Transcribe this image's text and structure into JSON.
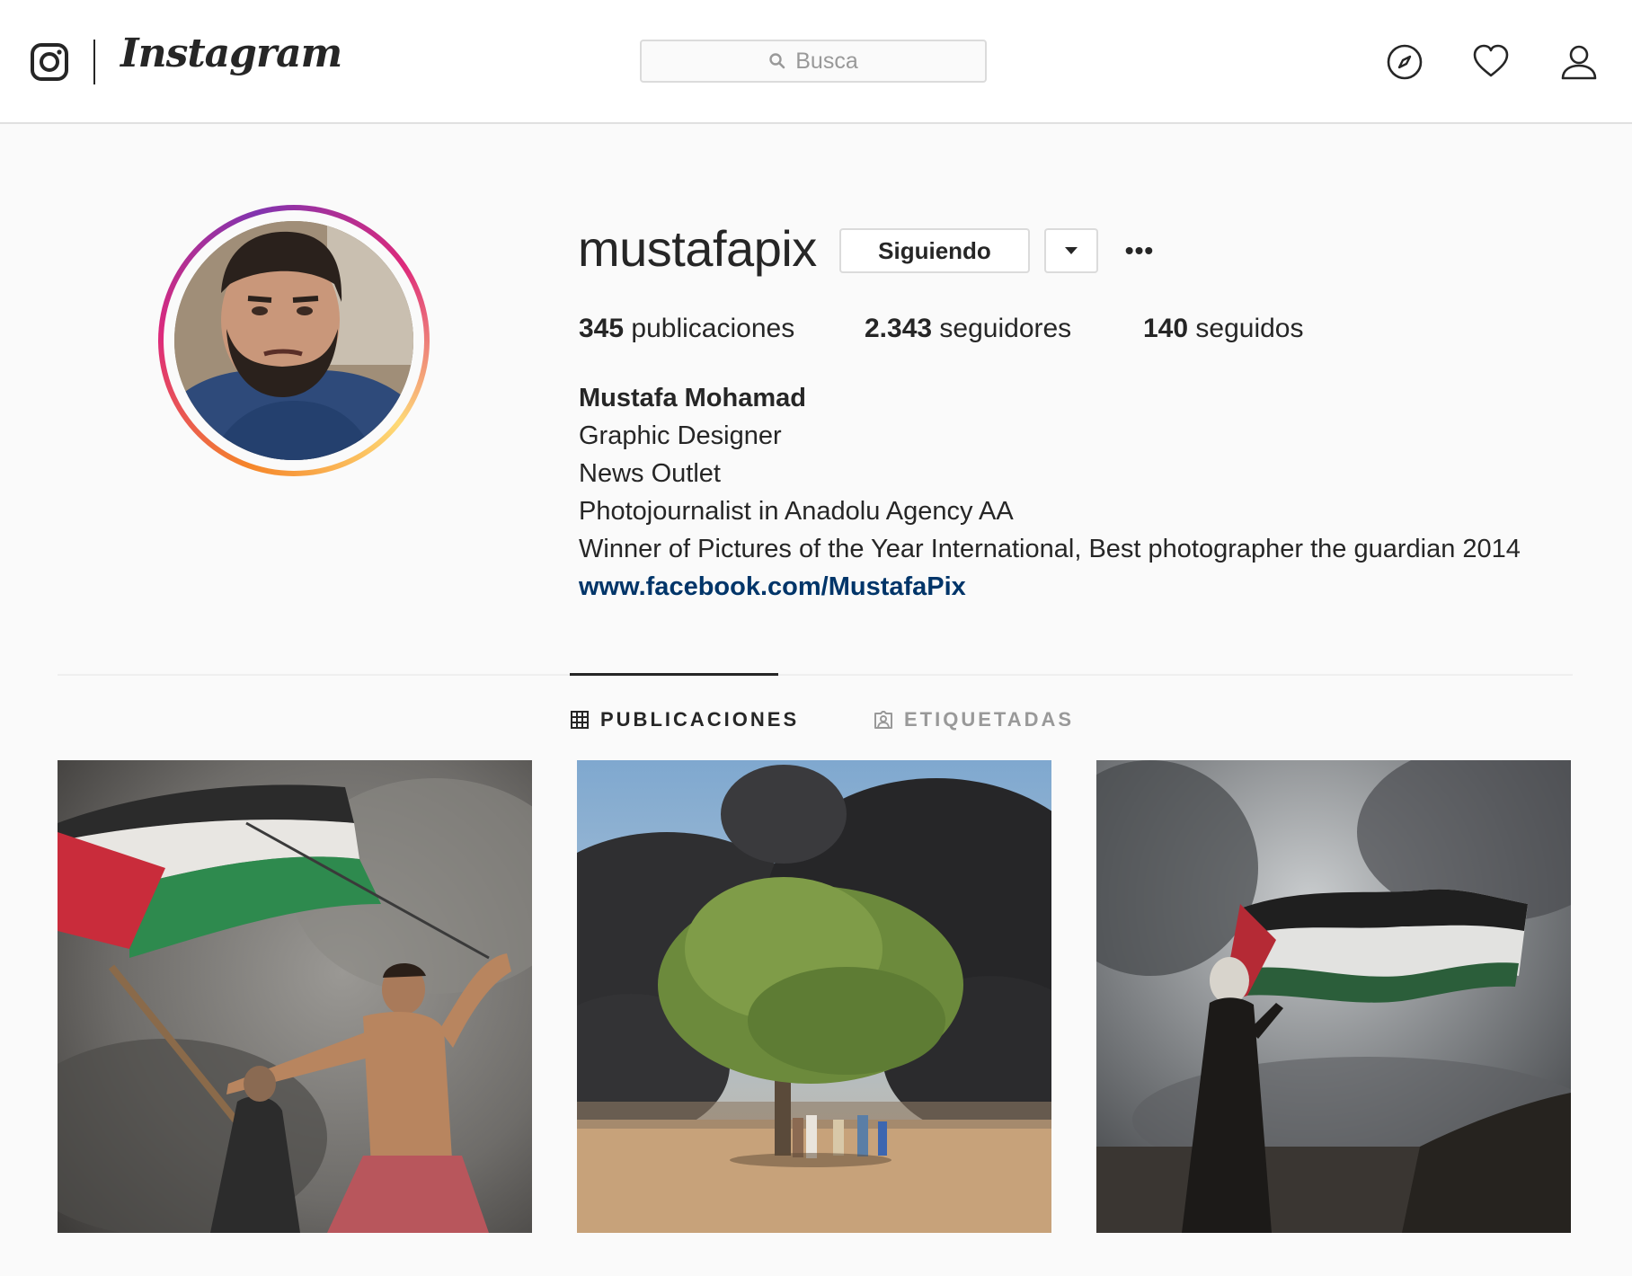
{
  "header": {
    "brand": "Instagram",
    "search_placeholder": "Busca"
  },
  "profile": {
    "username": "mustafapix",
    "follow_button": "Siguiendo",
    "stats": [
      {
        "count": "345",
        "label": "publicaciones"
      },
      {
        "count": "2.343",
        "label": "seguidores"
      },
      {
        "count": "140",
        "label": "seguidos"
      }
    ],
    "full_name": "Mustafa Mohamad",
    "bio_lines": [
      "Graphic Designer",
      "News Outlet",
      "Photojournalist in Anadolu Agency AA",
      "Winner of Pictures of the Year International, Best photographer the guardian 2014"
    ],
    "website": "www.facebook.com/MustafaPix"
  },
  "tabs": [
    {
      "label": "PUBLICACIONES",
      "icon": "grid-icon",
      "active": true
    },
    {
      "label": "ETIQUETADAS",
      "icon": "tagged-person-icon",
      "active": false
    }
  ],
  "posts": [
    {
      "icon": "photo-flag-protester"
    },
    {
      "icon": "photo-tree-smoke"
    },
    {
      "icon": "photo-woman-flag"
    }
  ],
  "icons": [
    "instagram-glyph-icon",
    "search-icon",
    "compass-icon",
    "heart-icon",
    "profile-icon",
    "caret-down-icon",
    "more-options-icon"
  ],
  "colors": {
    "link": "#003569",
    "muted_text": "#999999",
    "border": "#dbdbdb",
    "background": "#fafafa"
  }
}
